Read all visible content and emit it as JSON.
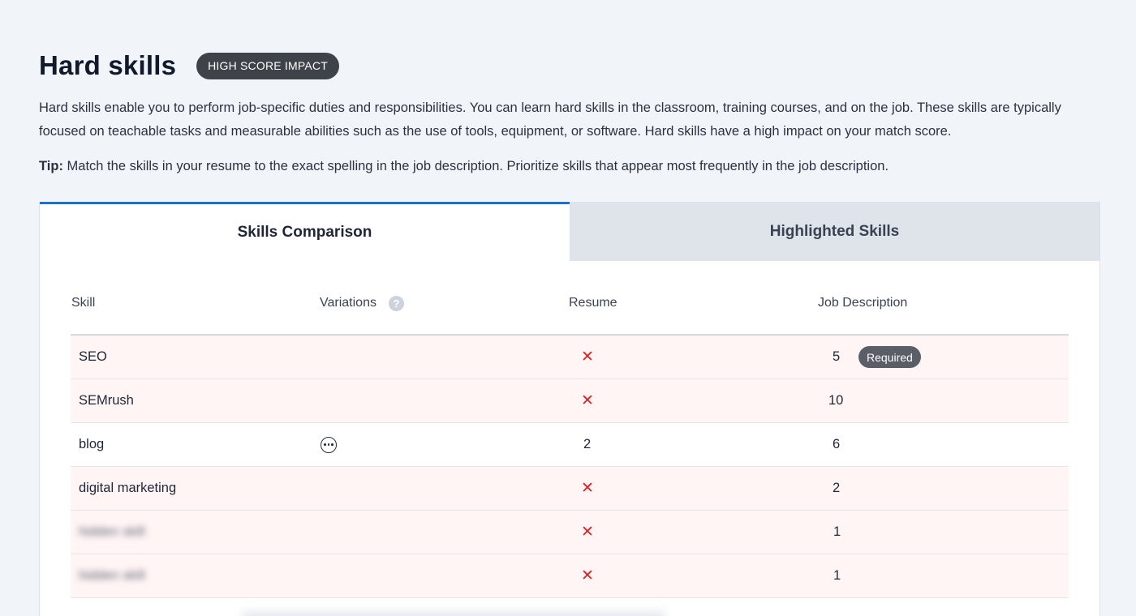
{
  "section": {
    "title": "Hard skills",
    "badge": "HIGH SCORE IMPACT",
    "description": "Hard skills enable you to perform job-specific duties and responsibilities. You can learn hard skills in the classroom, training courses, and on the job. These skills are typically focused on teachable tasks and measurable abilities such as the use of tools, equipment, or software. Hard skills have a high impact on your match score.",
    "tip_label": "Tip:",
    "tip_text": " Match the skills in your resume to the exact spelling in the job description. Prioritize skills that appear most frequently in the job description."
  },
  "tabs": [
    {
      "label": "Skills Comparison",
      "active": true
    },
    {
      "label": "Highlighted Skills",
      "active": false
    }
  ],
  "table": {
    "headers": {
      "skill": "Skill",
      "variations": "Variations",
      "resume": "Resume",
      "job_description": "Job Description"
    },
    "help_icon": "question-circle-icon",
    "rows": [
      {
        "skill": "SEO",
        "variations": "",
        "resume": "✕",
        "jd": "5",
        "required_label": "Required"
      },
      {
        "skill": "SEMrush",
        "variations": "",
        "resume": "✕",
        "jd": "10",
        "required_label": ""
      },
      {
        "skill": "blog",
        "variations": "more-options-icon",
        "resume": "2",
        "jd": "6",
        "required_label": ""
      },
      {
        "skill": "digital marketing",
        "variations": "",
        "resume": "✕",
        "jd": "2",
        "required_label": ""
      },
      {
        "skill": "hidden skill",
        "variations": "",
        "resume": "✕",
        "jd": "1",
        "required_label": ""
      },
      {
        "skill": "hidden skill",
        "variations": "",
        "resume": "✕",
        "jd": "1",
        "required_label": ""
      }
    ]
  },
  "colors": {
    "accent": "#1a73c8",
    "missing_mark": "#e02020",
    "missing_row_bg": "#fff5f5",
    "badge_bg": "#3e4249"
  }
}
